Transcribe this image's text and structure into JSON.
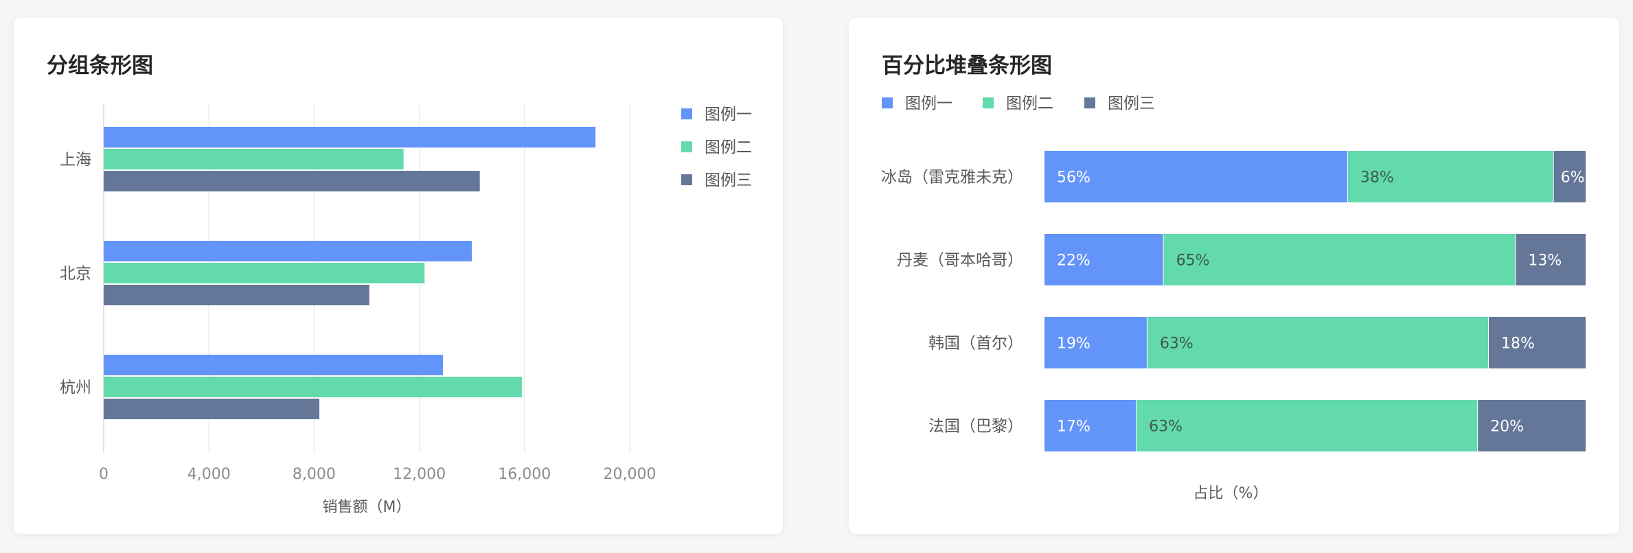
{
  "left_chart": {
    "title": "分组条形图",
    "xlabel": "销售额（M）",
    "legend": [
      "图例一",
      "图例二",
      "图例三"
    ],
    "colors": [
      "#6394f9",
      "#62daab",
      "#657798"
    ]
  },
  "right_chart": {
    "title": "百分比堆叠条形图",
    "xlabel": "占比（%）",
    "legend": [
      "图例一",
      "图例二",
      "图例三"
    ],
    "colors": [
      "#6394f9",
      "#62daab",
      "#657798"
    ]
  },
  "chart_data": [
    {
      "type": "bar",
      "orientation": "horizontal",
      "title": "分组条形图",
      "xlabel": "销售额（M）",
      "ylabel": "",
      "categories": [
        "上海",
        "北京",
        "杭州"
      ],
      "series": [
        {
          "name": "图例一",
          "values": [
            18700,
            14000,
            12900
          ]
        },
        {
          "name": "图例二",
          "values": [
            11400,
            12200,
            15900
          ]
        },
        {
          "name": "图例三",
          "values": [
            14300,
            10100,
            8200
          ]
        }
      ],
      "xlim": [
        0,
        20000
      ],
      "xticks": [
        "0",
        "4,000",
        "8,000",
        "12,000",
        "16,000",
        "20,000"
      ],
      "grid": true,
      "legend_position": "top-right"
    },
    {
      "type": "bar",
      "orientation": "horizontal",
      "stacked": "percent",
      "title": "百分比堆叠条形图",
      "xlabel": "占比（%）",
      "ylabel": "",
      "categories": [
        "冰岛（雷克雅未克）",
        "丹麦（哥本哈哥）",
        "韩国（首尔）",
        "法国（巴黎）"
      ],
      "series": [
        {
          "name": "图例一",
          "values": [
            56,
            22,
            19,
            17
          ]
        },
        {
          "name": "图例二",
          "values": [
            38,
            65,
            63,
            63
          ]
        },
        {
          "name": "图例三",
          "values": [
            6,
            13,
            18,
            20
          ]
        }
      ],
      "data_labels": [
        [
          "56%",
          "38%",
          "6%"
        ],
        [
          "22%",
          "65%",
          "13%"
        ],
        [
          "19%",
          "63%",
          "18%"
        ],
        [
          "17%",
          "63%",
          "20%"
        ]
      ],
      "xlim": [
        0,
        100
      ],
      "grid": false,
      "legend_position": "top-left"
    }
  ]
}
